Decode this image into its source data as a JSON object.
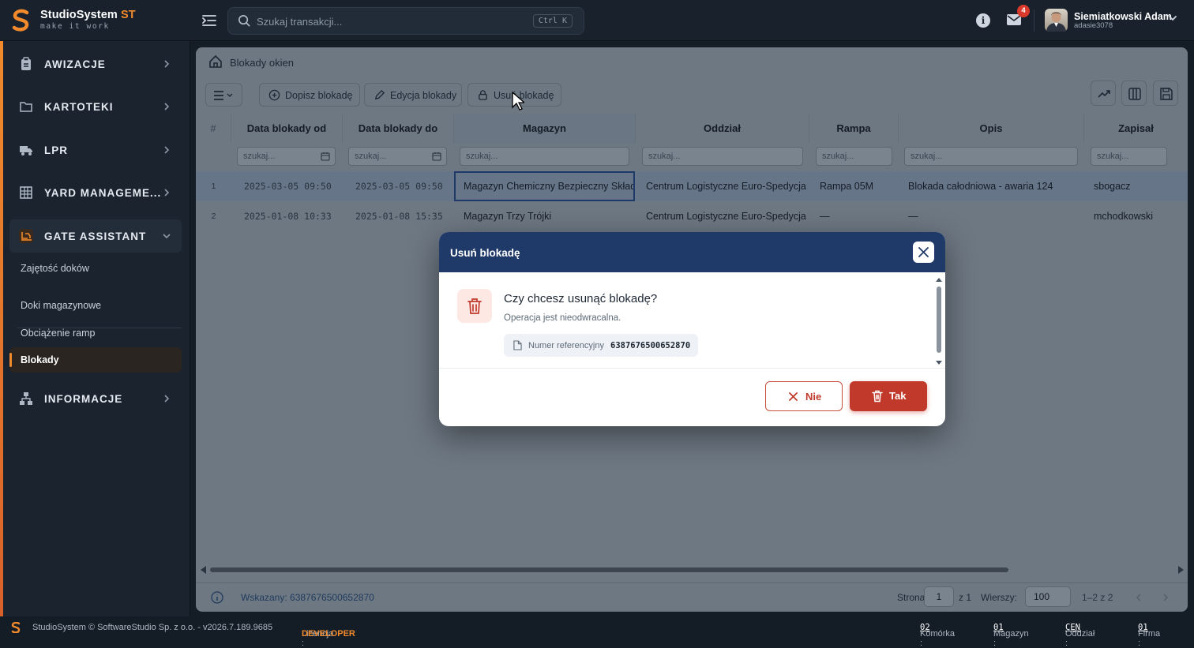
{
  "app": {
    "brand": "StudioSystem",
    "brand_suffix": "ST",
    "tagline": "make it work"
  },
  "search": {
    "placeholder": "Szukaj transakcji...",
    "shortcut": "Ctrl K"
  },
  "notifications": {
    "mail_count": "4"
  },
  "user": {
    "name": "Siemiatkowski Adam",
    "login": "adasie3078"
  },
  "sidebar": {
    "items": [
      {
        "label": "AWIZACJE",
        "icon": "clipboard-icon"
      },
      {
        "label": "KARTOTEKI",
        "icon": "folder-icon"
      },
      {
        "label": "LPR",
        "icon": "truck-icon"
      },
      {
        "label": "YARD MANAGEME...",
        "icon": "grid-icon"
      },
      {
        "label": "GATE ASSISTANT",
        "icon": "forklift-icon"
      },
      {
        "label": "INFORMACJE",
        "icon": "sitemap-icon"
      }
    ],
    "sub_items": [
      "Zajętość doków",
      "Doki magazynowe",
      "Obciążenie ramp",
      "Blokady"
    ]
  },
  "breadcrumb": {
    "title": "Blokady okien"
  },
  "toolbar": {
    "add": "Dopisz blokadę",
    "edit": "Edycja blokady",
    "delete": "Usuń blokadę"
  },
  "table": {
    "columns": [
      "#",
      "Data blokady od",
      "Data blokady do",
      "Magazyn",
      "Oddział",
      "Rampa",
      "Opis",
      "Zapisał"
    ],
    "filter_placeholder": "szukaj...",
    "rows": [
      {
        "n": "1",
        "od": "2025-03-05 09:50",
        "do": "2025-03-05 09:50",
        "magazyn": "Magazyn Chemiczny Bezpieczny Skład",
        "oddzial": "Centrum Logistyczne Euro-Spedycja",
        "rampa": "Rampa 05M",
        "opis": "Blokada całodniowa - awaria 124",
        "zapisal": "sbogacz"
      },
      {
        "n": "2",
        "od": "2025-01-08 10:33",
        "do": "2025-01-08 15:35",
        "magazyn": "Magazyn Trzy Trójki",
        "oddzial": "Centrum Logistyczne Euro-Spedycja",
        "rampa": "—",
        "opis": "—",
        "zapisal": "mchodkowski"
      }
    ]
  },
  "footer": {
    "selected": "Wskazany: 6387676500652870",
    "page_label": "Strona",
    "page": "1",
    "page_of": "z 1",
    "rows_label": "Wierszy:",
    "rows": "100",
    "range": "1–2 z 2"
  },
  "statusbar": {
    "copyright": "StudioSystem © SoftwareStudio Sp. z o.o. - v2026.7.189.9685",
    "license_label": "Licencja :",
    "license": "DEVELOPER",
    "komorka_label": "Komórka :",
    "komorka": "02",
    "magazyn_label": "Magazyn :",
    "magazyn": "01",
    "oddzial_label": "Oddział :",
    "oddzial": "CEN",
    "firma_label": "Firma :",
    "firma": "01"
  },
  "modal": {
    "title": "Usuń blokadę",
    "question": "Czy chcesz usunąć blokadę?",
    "subtitle": "Operacja jest nieodwracalna.",
    "ref_label": "Numer referencyjny",
    "ref_value": "6387676500652870",
    "no": "Nie",
    "yes": "Tak"
  },
  "colors": {
    "accent": "#f08a2c",
    "danger": "#c0392b",
    "header": "#1f3a68"
  }
}
